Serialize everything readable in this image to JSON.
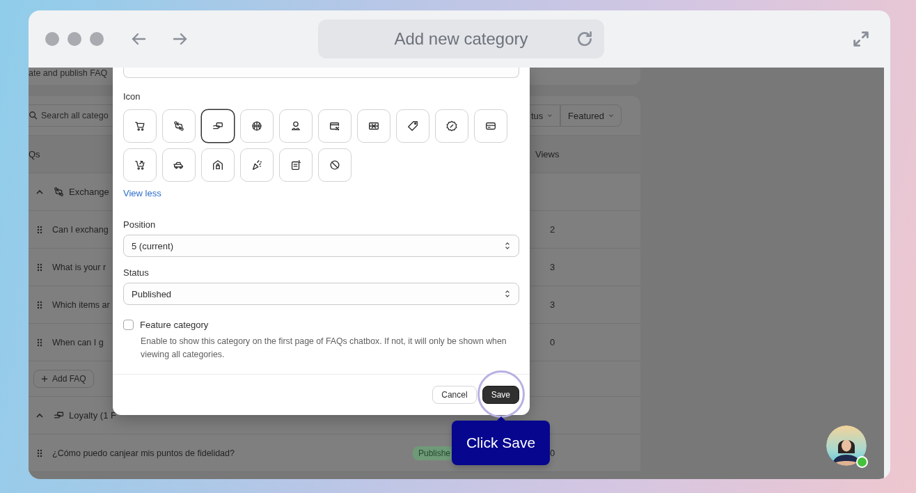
{
  "browser": {
    "address": "Add new category"
  },
  "page": {
    "subtitle": "ate and publish FAQ",
    "search": {
      "placeholder": "Search all catego"
    },
    "filters": [
      "tus",
      "Featured"
    ],
    "columns": {
      "column_1": "Qs",
      "views": "Views"
    },
    "groups": [
      {
        "title": "Exchange",
        "expanded": true,
        "faqs": [
          {
            "question": "Can I exchang",
            "views": "2"
          },
          {
            "question": "What is your r",
            "views": "3"
          },
          {
            "question": "Which items ar",
            "views": "3"
          },
          {
            "question": "When can I g",
            "views": "0"
          }
        ],
        "add_button": "Add FAQ"
      },
      {
        "title": "Loyalty (1 F",
        "expanded": true,
        "faqs": [
          {
            "question": "¿Cómo puedo canjear mis puntos de fidelidad?",
            "status": "Publishe",
            "views": "0"
          }
        ]
      }
    ]
  },
  "dialog": {
    "icon_label": "Icon",
    "icons": [
      {
        "selected": false
      },
      {
        "selected": false
      },
      {
        "selected": true
      },
      {
        "selected": false
      },
      {
        "selected": false
      },
      {
        "selected": false
      },
      {
        "selected": false
      },
      {
        "selected": false
      },
      {
        "selected": false
      },
      {
        "selected": false
      },
      {
        "selected": false
      },
      {
        "selected": false
      },
      {
        "selected": false
      },
      {
        "selected": false
      },
      {
        "selected": false
      },
      {
        "selected": false
      }
    ],
    "view_less": "View less",
    "position": {
      "label": "Position",
      "value": "5 (current)"
    },
    "status": {
      "label": "Status",
      "value": "Published"
    },
    "feature": {
      "label": "Feature category",
      "checked": false,
      "help": "Enable to show this category on the first page of FAQs chatbox. If not, it will only be shown when viewing all categories."
    },
    "buttons": [
      {
        "label": "Cancel",
        "kind": "secondary"
      },
      {
        "label": "Save",
        "kind": "primary"
      }
    ]
  },
  "tooltip": {
    "text": "Click Save"
  }
}
